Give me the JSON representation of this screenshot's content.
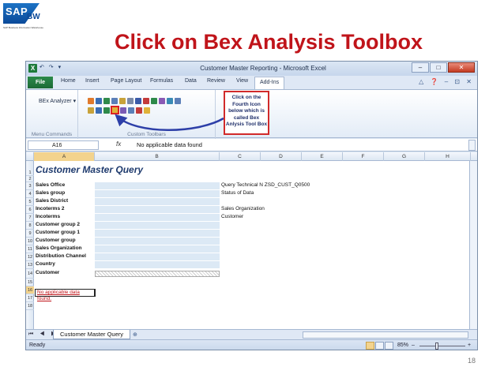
{
  "slide": {
    "title": "Click on Bex Analysis Toolbox",
    "page_number": "18",
    "logo": {
      "brand": "SAP",
      "product": "BW",
      "tagline": "SAP Business Information Warehouse"
    }
  },
  "window": {
    "app_icon": "X",
    "quick_access": "↶ ↷ ▾",
    "title": "Customer Master Reporting - Microsoft Excel",
    "minimize": "–",
    "maximize": "□",
    "close": "✕"
  },
  "ribbon_tabs": [
    "File",
    "Home",
    "Insert",
    "Page Layout",
    "Formulas",
    "Data",
    "Review",
    "View",
    "Add-Ins"
  ],
  "ribbon_tab_icons": "△ ❓ – ⊡ ✕",
  "ribbon": {
    "bex_analyzer": "BEx Analyzer ▾",
    "group_menu_commands": "Menu Commands",
    "group_custom_toolbars": "Custom Toolbars"
  },
  "callout": {
    "text": "Click on the Fourth Icon below which is called Bex Anlysis Tool Box"
  },
  "formula_bar": {
    "name_box": "A16",
    "fx": "fx",
    "content": "No applicable data found"
  },
  "columns": [
    "A",
    "B",
    "C",
    "D",
    "E",
    "F",
    "G",
    "H"
  ],
  "rows": [
    "1",
    "2",
    "3",
    "4",
    "5",
    "6",
    "7",
    "8",
    "9",
    "10",
    "11",
    "12",
    "13",
    "14",
    "15",
    "16",
    "17",
    "18"
  ],
  "query": {
    "title": "Customer Master Query",
    "labels": [
      "Sales Office",
      "Sales group",
      "Sales District",
      "Incoterms 2",
      "Incoterms",
      "Customer group 2",
      "Customer group 1",
      "Customer group",
      "Sales Organization",
      "Distribution Channel",
      "Country",
      "Customer"
    ],
    "info_technical_name": "Query Technical N ZSD_CUST_Q0500",
    "info_status": "Status of Data",
    "info_sales_org": "Sales Organization",
    "info_customer": "Customer",
    "no_data": "No applicable data found."
  },
  "sheet": {
    "nav": "⏮ ◀ ▶ ⏭",
    "tab_label": "Customer Master Query",
    "new_sheet": "⊕"
  },
  "status_bar": {
    "ready": "Ready",
    "zoom": "85%",
    "zoom_minus": "–",
    "zoom_plus": "+"
  },
  "colors": {
    "title_red": "#c0141a",
    "excel_green": "#1d7a3a",
    "callout_border": "#d12a2a",
    "arrow_blue": "#2d3fa8",
    "query_fill": "#dce9f5"
  }
}
